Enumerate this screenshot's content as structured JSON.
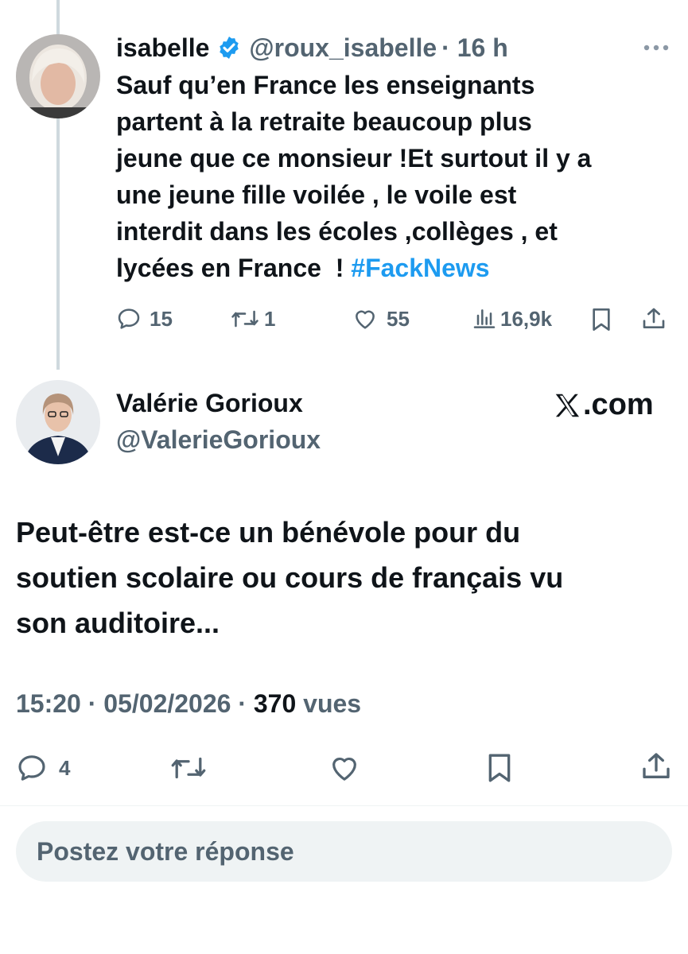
{
  "reply_tweet": {
    "author_name": "isabelle",
    "handle": "@roux_isabelle",
    "time": "· 16 h",
    "text_lines": [
      "Sauf qu’en France les enseignants",
      "partent à la retraite beaucoup plus",
      "jeune que ce monsieur !Et surtout il y a",
      "une jeune fille voilée , le voile est",
      "interdit dans les écoles ,collèges , et",
      "lycées en France  ! "
    ],
    "hashtag": "#FackNews",
    "replies": "15",
    "reposts": "1",
    "likes": "55",
    "views": "16,9k",
    "icons": [
      "verified-badge-icon",
      "more-icon",
      "reply-icon",
      "repost-icon",
      "like-icon",
      "views-icon",
      "bookmark-icon",
      "share-icon"
    ]
  },
  "main_tweet": {
    "author_name": "Valérie Gorioux",
    "handle": "@ValerieGorioux",
    "site_label": ".com",
    "text_lines": [
      "Peut-être est-ce un bénévole pour du",
      "soutien scolaire ou cours de français vu",
      "son auditoire..."
    ],
    "time": "15:20",
    "sep1": " · ",
    "date": "05/02/2026",
    "sep2": " · ",
    "views_count": "370",
    "views_label": " vues",
    "replies": "4",
    "icons": [
      "reply-icon",
      "repost-icon",
      "like-icon",
      "bookmark-icon",
      "share-icon",
      "x-logo-icon"
    ]
  },
  "reply_box": {
    "placeholder": "Postez votre réponse"
  },
  "colors": {
    "accent": "#1d9bf0",
    "muted": "#536471",
    "text": "#0f1419"
  }
}
